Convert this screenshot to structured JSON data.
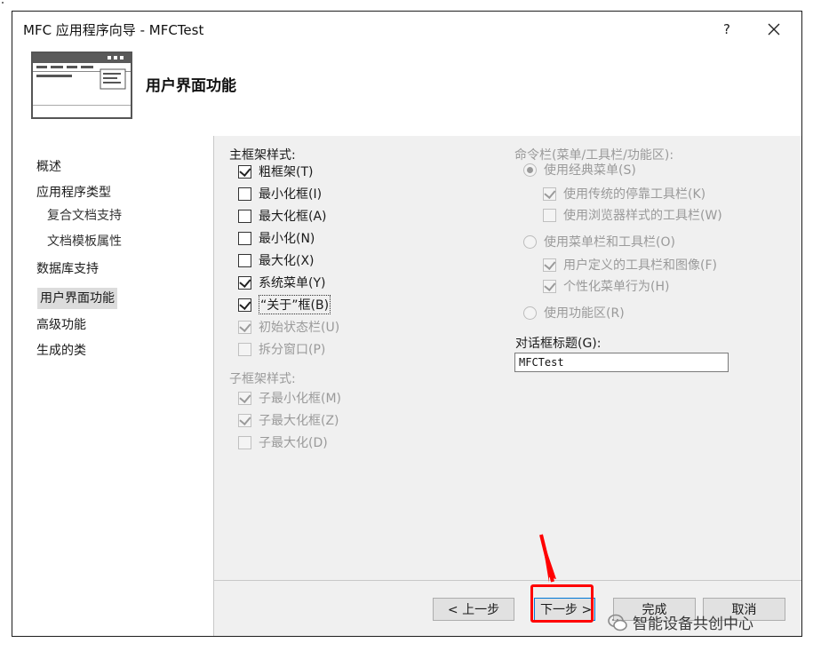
{
  "window": {
    "title": "MFC 应用程序向导 - MFCTest",
    "help_label": "?"
  },
  "header": {
    "page_title": "用户界面功能"
  },
  "nav": {
    "items": [
      {
        "label": "概述"
      },
      {
        "label": "应用程序类型"
      },
      {
        "label": "复合文档支持"
      },
      {
        "label": "文档模板属性"
      },
      {
        "label": "数据库支持"
      },
      {
        "label": "用户界面功能",
        "selected": true
      },
      {
        "label": "高级功能"
      },
      {
        "label": "生成的类"
      }
    ]
  },
  "main_frame": {
    "label": "主框架样式:",
    "options": [
      {
        "label": "粗框架(T)",
        "checked": true,
        "enabled": true
      },
      {
        "label": "最小化框(I)",
        "checked": false,
        "enabled": true
      },
      {
        "label": "最大化框(A)",
        "checked": false,
        "enabled": true
      },
      {
        "label": "最小化(N)",
        "checked": false,
        "enabled": true
      },
      {
        "label": "最大化(X)",
        "checked": false,
        "enabled": true
      },
      {
        "label": "系统菜单(Y)",
        "checked": true,
        "enabled": true
      },
      {
        "label": "“关于”框(B)",
        "checked": true,
        "enabled": true
      },
      {
        "label": "初始状态栏(U)",
        "checked": true,
        "enabled": false
      },
      {
        "label": "拆分窗口(P)",
        "checked": false,
        "enabled": false
      }
    ]
  },
  "child_frame": {
    "label": "子框架样式:",
    "options": [
      {
        "label": "子最小化框(M)",
        "checked": true,
        "enabled": false
      },
      {
        "label": "子最大化框(Z)",
        "checked": true,
        "enabled": false
      },
      {
        "label": "子最大化(D)",
        "checked": false,
        "enabled": false
      }
    ]
  },
  "command_bar": {
    "label": "命令栏(菜单/工具栏/功能区):",
    "radio_classic": "使用经典菜单(S)",
    "classic_legacy_toolbar": "使用传统的停靠工具栏(K)",
    "classic_browser_toolbar": "使用浏览器样式的工具栏(W)",
    "radio_menubar_toolbar": "使用菜单栏和工具栏(O)",
    "user_defined_toolbar": "用户定义的工具栏和图像(F)",
    "personalized_menu": "个性化菜单行为(H)",
    "radio_ribbon": "使用功能区(R)"
  },
  "dialog_title": {
    "label": "对话框标题(G):",
    "value": "MFCTest"
  },
  "buttons": {
    "prev": "< 上一步",
    "next": "下一步 >",
    "finish": "完成",
    "cancel": "取消"
  },
  "watermark": {
    "text": "智能设备共创中心"
  },
  "colors": {
    "highlight_red": "#ff0000",
    "dialog_bg": "#f0f0f0"
  }
}
